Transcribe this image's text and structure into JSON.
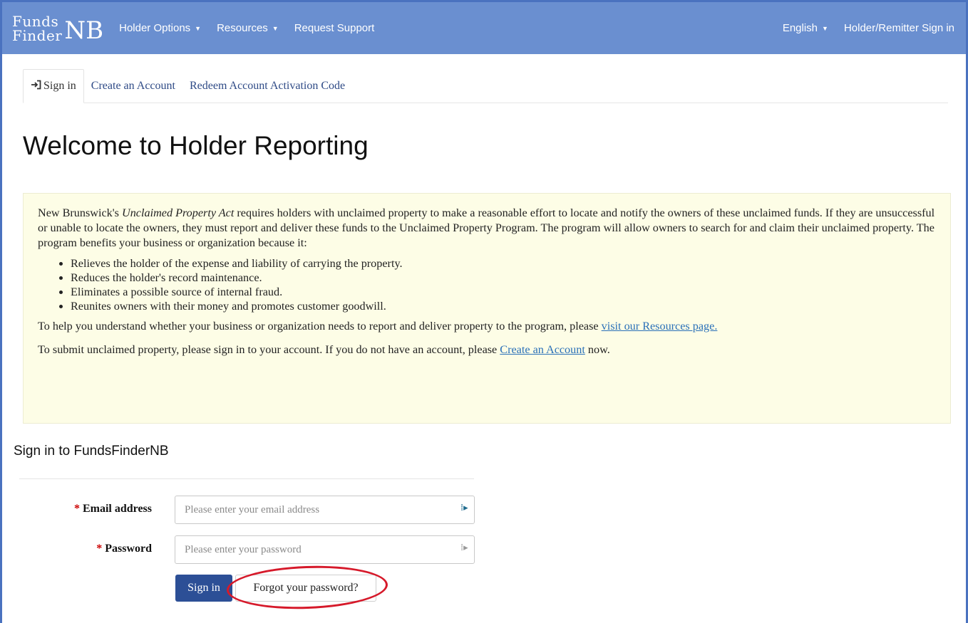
{
  "brand": {
    "line1": "Funds",
    "line2": "Finder",
    "suffix": "NB"
  },
  "nav": {
    "holder_options": "Holder Options",
    "resources": "Resources",
    "request_support": "Request Support",
    "language": "English",
    "sign_in": "Holder/Remitter Sign in"
  },
  "tabs": {
    "sign_in": "Sign in",
    "create_account": "Create an Account",
    "redeem": "Redeem Account Activation Code"
  },
  "page": {
    "title": "Welcome to Holder Reporting"
  },
  "info": {
    "intro_pre": "New Brunswick's ",
    "intro_act": "Unclaimed Property Act",
    "intro_post": " requires holders with unclaimed property to make a reasonable effort to locate and notify the owners of these unclaimed funds. If they are unsuccessful or unable to locate the owners, they must report and deliver these funds to the Unclaimed Property Program. The program will allow owners to search for and claim their unclaimed property. The program benefits your business or organization because it:",
    "benefits": [
      "Relieves the holder of the expense and liability of carrying the property.",
      "Reduces the holder's record maintenance.",
      "Eliminates a possible source of internal fraud.",
      "Reunites owners with their money and promotes customer goodwill."
    ],
    "resources_pre": "To help you understand whether your business or organization needs to report and deliver property to the program, please ",
    "resources_link": "visit our Resources page.",
    "account_pre": "To submit unclaimed property, please sign in to your account. If you do not have an account, please ",
    "account_link": "Create an Account",
    "account_post": " now."
  },
  "signin": {
    "title": "Sign in to FundsFinderNB",
    "required_mark": "*",
    "email_label": "Email address",
    "email_placeholder": "Please enter your email address",
    "password_label": "Password",
    "password_placeholder": "Please enter your password",
    "submit": "Sign in",
    "forgot": "Forgot your password?"
  },
  "colors": {
    "navbar": "#6a8fd0",
    "primary_button": "#2c4f96",
    "highlight": "#d6192a",
    "info_bg": "#fdfde6"
  }
}
